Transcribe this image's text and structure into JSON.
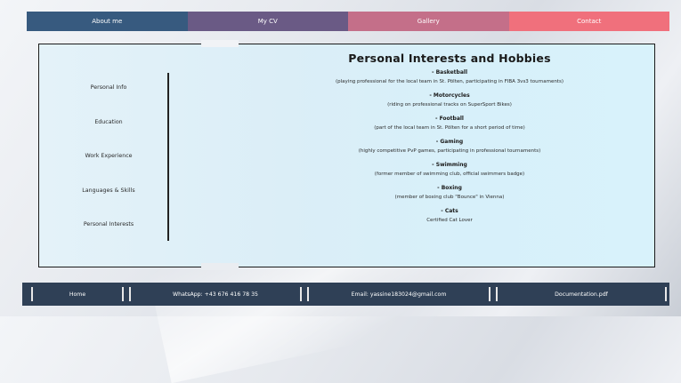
{
  "nav": [
    {
      "label": "About me",
      "color": "#375a7f"
    },
    {
      "label": "My CV",
      "color": "#6a5a85"
    },
    {
      "label": "Gallery",
      "color": "#c46f89"
    },
    {
      "label": "Contact",
      "color": "#f0707c"
    }
  ],
  "sidebar": {
    "items": [
      "Personal Info",
      "Education",
      "Work Experience",
      "Languages & Skills",
      "Personal Interests"
    ]
  },
  "main": {
    "title": "Personal Interests and Hobbies",
    "hobbies": [
      {
        "name": "- Basketball",
        "desc": "(playing professional for the local team in St. Pölten, participating in FIBA 3vs3 tournaments)"
      },
      {
        "name": "- Motorcycles",
        "desc": "(riding on professional tracks on SuperSport Bikes)"
      },
      {
        "name": "- Football",
        "desc": "(part of the local team in St. Pölten for a short period of time)"
      },
      {
        "name": "- Gaming",
        "desc": "(highly competitive PvP games, participating in professional tournaments)"
      },
      {
        "name": "- Swimming",
        "desc": "(former member of swimming club, official swimmers badge)"
      },
      {
        "name": "- Boxing",
        "desc": "(member of boxing club \"Bounce\" in Vienna)"
      },
      {
        "name": "- Cats",
        "desc": "Certified Cat Lover"
      }
    ]
  },
  "footer": {
    "home": "Home",
    "whatsapp": "WhatsApp: +43 676 416 78 35",
    "email": "Email: yassine183024@gmail.com",
    "docs": "Documentation.pdf"
  }
}
